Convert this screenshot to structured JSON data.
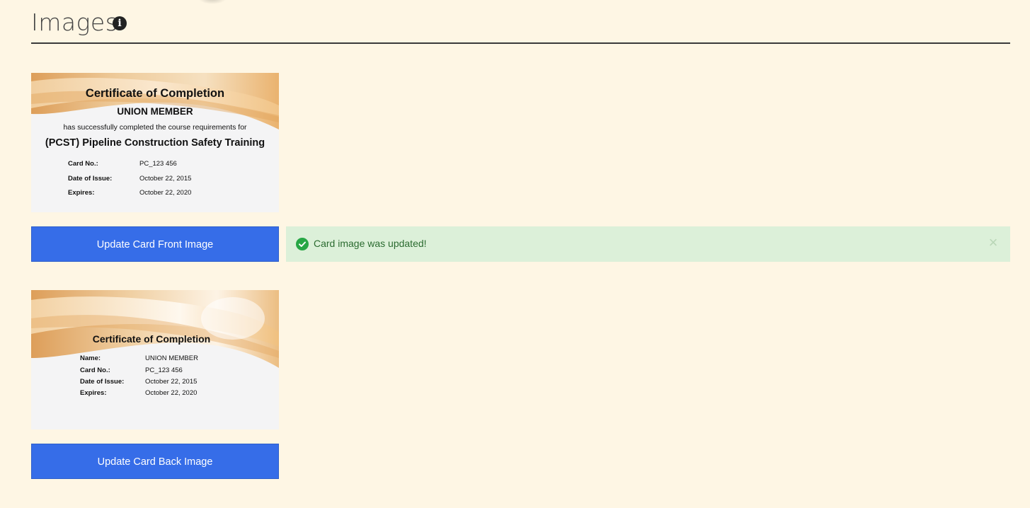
{
  "header": {
    "title": "Images",
    "info_icon": "info-circle-icon"
  },
  "front_card": {
    "title": "Certificate of Completion",
    "name": "UNION MEMBER",
    "description": "has successfully completed the course requirements for",
    "course": "(PCST) Pipeline Construction Safety Training",
    "fields": [
      {
        "label": "Card No.:",
        "value": "PC_123 456"
      },
      {
        "label": "Date of Issue:",
        "value": "October 22, 2015"
      },
      {
        "label": "Expires:",
        "value": "October 22, 2020"
      }
    ]
  },
  "front_button": {
    "label": "Update Card Front Image"
  },
  "alert": {
    "message": "Card image was updated!",
    "close_glyph": "×",
    "icon": "check-circle-icon",
    "color": "#27a745"
  },
  "back_card": {
    "title": "Certificate of Completion",
    "fields": [
      {
        "label": "Name:",
        "value": "UNION MEMBER"
      },
      {
        "label": "Card No.:",
        "value": "PC_123 456"
      },
      {
        "label": "Date of Issue:",
        "value": "October 22, 2015"
      },
      {
        "label": "Expires:",
        "value": "October 22, 2020"
      }
    ]
  },
  "back_button": {
    "label": "Update Card Back Image"
  },
  "colors": {
    "background": "#fef6e4",
    "button": "#366de8",
    "alert_bg": "#dcf0d9",
    "alert_text": "#2b6b30"
  }
}
